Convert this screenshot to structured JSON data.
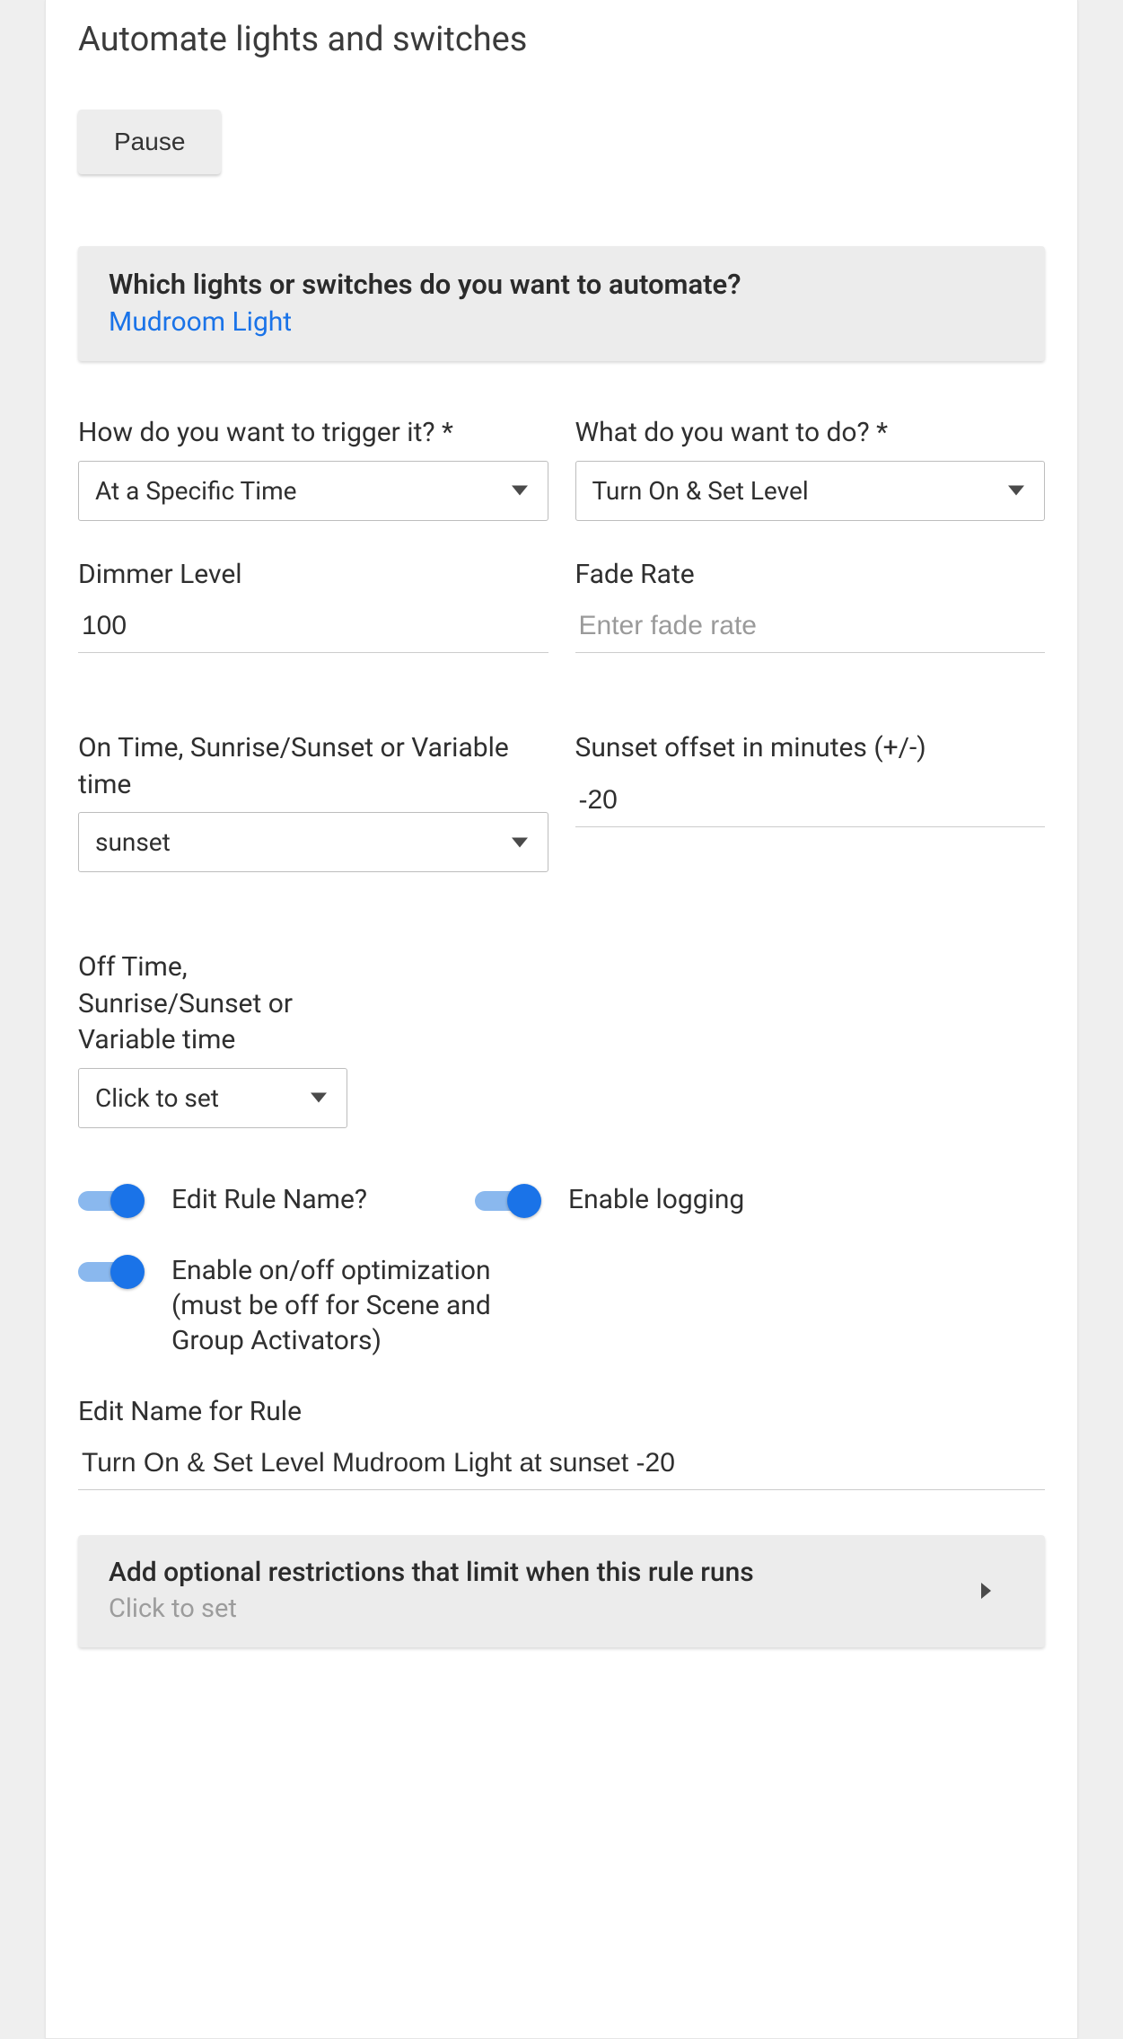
{
  "title": "Automate lights and switches",
  "pause_button": "Pause",
  "which_box": {
    "question": "Which lights or switches do you want to automate?",
    "device_link": "Mudroom Light"
  },
  "trigger": {
    "label": "How do you want to trigger it? *",
    "value": "At a Specific Time"
  },
  "action": {
    "label": "What do you want to do? *",
    "value": "Turn On & Set Level"
  },
  "dimmer": {
    "label": "Dimmer Level",
    "value": "100"
  },
  "fade": {
    "label": "Fade Rate",
    "placeholder": "Enter fade rate",
    "value": ""
  },
  "on_time": {
    "label": "On Time, Sunrise/Sunset or Variable time",
    "value": "sunset"
  },
  "sunset_offset": {
    "label": "Sunset offset in minutes (+/-)",
    "value": "-20"
  },
  "off_time": {
    "label": "Off Time, Sunrise/Sunset or Variable time",
    "value": "Click to set"
  },
  "toggles": {
    "edit_rule_name": {
      "label": "Edit Rule Name?",
      "on": true
    },
    "enable_logging": {
      "label": "Enable logging",
      "on": true
    },
    "optimization": {
      "label": "Enable on/off optimization (must be off for Scene and Group Activators)",
      "on": true
    }
  },
  "rule_name": {
    "label": "Edit Name for Rule",
    "value": "Turn On & Set Level Mudroom Light at sunset -20"
  },
  "restrictions": {
    "title": "Add optional restrictions that limit when this rule runs",
    "sub": "Click to set"
  }
}
